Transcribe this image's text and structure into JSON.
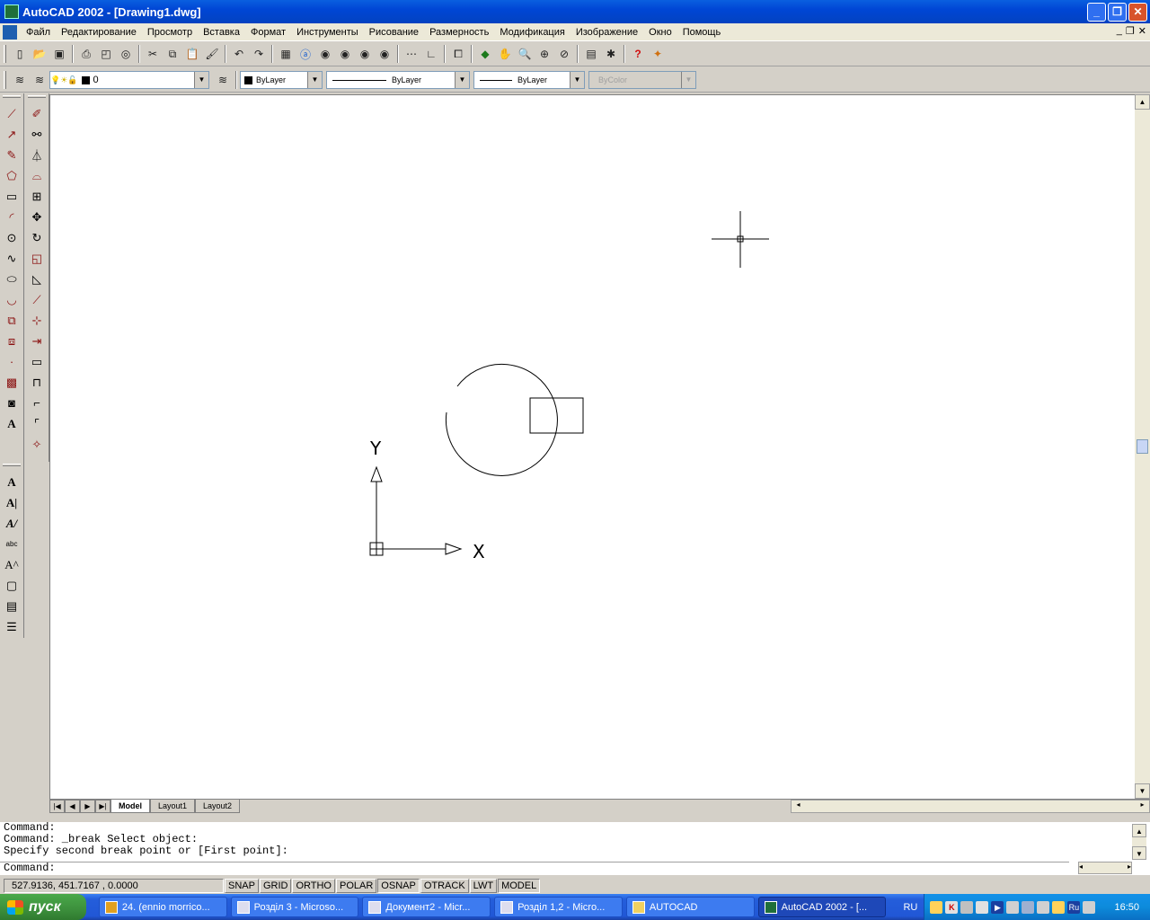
{
  "window": {
    "title": "AutoCAD 2002 - [Drawing1.dwg]",
    "buttons": [
      "_",
      "❐",
      "✕"
    ]
  },
  "menu": [
    "Файл",
    "Редактирование",
    "Просмотр",
    "Вставка",
    "Формат",
    "Инструменты",
    "Рисование",
    "Размерность",
    "Модификация",
    "Изображение",
    "Окно",
    "Помощь"
  ],
  "mdi_buttons": [
    "_",
    "❐",
    "✕"
  ],
  "standard_toolbar": [
    "new-icon",
    "open-icon",
    "save-icon",
    "print-icon",
    "print-preview-icon",
    "publish-icon",
    "cut-icon",
    "copy-icon",
    "paste-icon",
    "match-properties-icon",
    "undo-icon",
    "redo-icon",
    "design-center-icon",
    "today-icon",
    "web-icon",
    "web2-icon",
    "web3-icon",
    "web4-icon",
    "ucs-icon",
    "ucs2-icon",
    "named-views-icon",
    "3d-orbit-icon",
    "pan-icon",
    "zoom-realtime-icon",
    "zoom-window-icon",
    "zoom-previous-icon",
    "properties-icon",
    "design-center2-icon",
    "help-icon",
    "meet-now-icon"
  ],
  "layers_toolbar": {
    "layer_name": "0",
    "color": "ByLayer",
    "linetype": "ByLayer",
    "lineweight": "ByLayer",
    "plotstyle": "ByColor"
  },
  "draw_toolbar": [
    "line",
    "construction-line",
    "polyline",
    "polygon",
    "rectangle",
    "arc",
    "circle",
    "spline",
    "ellipse",
    "ellipse-arc",
    "insert-block",
    "make-block",
    "point",
    "hatch",
    "region",
    "multiline-text"
  ],
  "modify_toolbar": [
    "erase",
    "copy",
    "mirror",
    "offset",
    "array",
    "move",
    "rotate",
    "scale",
    "stretch",
    "lengthen",
    "trim",
    "extend",
    "break",
    "chamfer",
    "fillet",
    "explode"
  ],
  "text_toolbar": [
    "A",
    "A|",
    "A/",
    "abc",
    "A^",
    "frame",
    "A-box",
    "table"
  ],
  "layout_tabs": {
    "nav": [
      "|◀",
      "◀",
      "▶",
      "▶|"
    ],
    "tabs": [
      "Model",
      "Layout1",
      "Layout2"
    ],
    "active": "Model"
  },
  "axes": {
    "x_label": "X",
    "y_label": "Y"
  },
  "command_window": {
    "lines": [
      "Command:",
      "Command: _break Select object:",
      "Specify second break point or [First point]:"
    ],
    "prompt": "Command:"
  },
  "status": {
    "coords": "527.9136, 451.7167 , 0.0000",
    "toggles": [
      "SNAP",
      "GRID",
      "ORTHO",
      "POLAR",
      "OSNAP",
      "OTRACK",
      "LWT",
      "MODEL"
    ],
    "toggles_on": [
      "OSNAP",
      "MODEL"
    ]
  },
  "taskbar": {
    "start": "пуск",
    "tasks": [
      "24. (ennio morrico...",
      "Розділ 3 - Microso...",
      "Документ2 - Micr...",
      "Розділ 1,2 - Micro...",
      "AUTOCAD",
      "AutoCAD 2002 - [..."
    ],
    "active_task": "AutoCAD 2002 - [...",
    "lang": "RU",
    "tray_lang": "Ru",
    "clock": "16:50"
  }
}
